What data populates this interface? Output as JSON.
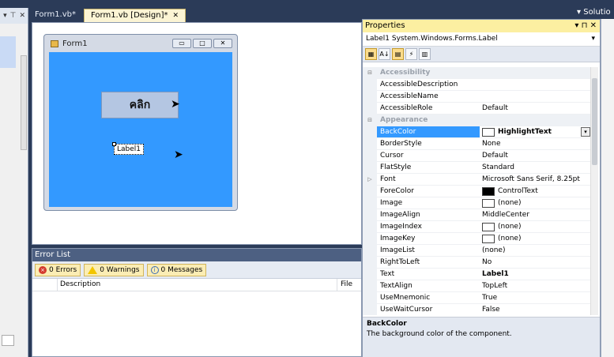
{
  "left_panel": {
    "header_glyphs": [
      "▾",
      "⊤",
      "✕"
    ]
  },
  "tabs": [
    {
      "label": "Form1.vb*",
      "active": false
    },
    {
      "label": "Form1.vb [Design]*",
      "active": true,
      "close": "✕"
    }
  ],
  "tabbar": {
    "overflow": "▾",
    "solution": "Solutio"
  },
  "designer": {
    "form_title": "Form1",
    "window_buttons": [
      "▭",
      "□",
      "✕"
    ],
    "back_color": "#3399ff",
    "button_text": "คลิก",
    "label_text": "Label1"
  },
  "error_list": {
    "title": "Error List",
    "errors": "0 Errors",
    "warnings": "0 Warnings",
    "messages": "0 Messages",
    "col_description": "Description",
    "col_file": "File"
  },
  "properties": {
    "title": "Properties",
    "title_buttons": [
      "▾",
      "⊓",
      "✕"
    ],
    "selected_object": "Label1  System.Windows.Forms.Label",
    "rows": [
      {
        "name": "Accessibility",
        "category": true,
        "glyph": "⊟"
      },
      {
        "name": "AccessibleDescription",
        "value": ""
      },
      {
        "name": "AccessibleName",
        "value": ""
      },
      {
        "name": "AccessibleRole",
        "value": "Default"
      },
      {
        "name": "Appearance",
        "category": true,
        "glyph": "⊟"
      },
      {
        "name": "BackColor",
        "value": "HighlightText",
        "swatch": "#ffffff",
        "selected": true,
        "bold": true
      },
      {
        "name": "BorderStyle",
        "value": "None"
      },
      {
        "name": "Cursor",
        "value": "Default"
      },
      {
        "name": "FlatStyle",
        "value": "Standard"
      },
      {
        "name": "Font",
        "value": "Microsoft Sans Serif, 8.25pt",
        "glyph": "▷"
      },
      {
        "name": "ForeColor",
        "value": "ControlText",
        "swatch": "#000000"
      },
      {
        "name": "Image",
        "value": "(none)",
        "swatch": "#ffffff"
      },
      {
        "name": "ImageAlign",
        "value": "MiddleCenter"
      },
      {
        "name": "ImageIndex",
        "value": "(none)",
        "swatch": "#ffffff"
      },
      {
        "name": "ImageKey",
        "value": "(none)",
        "swatch": "#ffffff"
      },
      {
        "name": "ImageList",
        "value": "(none)"
      },
      {
        "name": "RightToLeft",
        "value": "No"
      },
      {
        "name": "Text",
        "value": "Label1",
        "bold": true
      },
      {
        "name": "TextAlign",
        "value": "TopLeft"
      },
      {
        "name": "UseMnemonic",
        "value": "True"
      },
      {
        "name": "UseWaitCursor",
        "value": "False"
      }
    ],
    "description_title": "BackColor",
    "description_text": "The background color of the component."
  }
}
